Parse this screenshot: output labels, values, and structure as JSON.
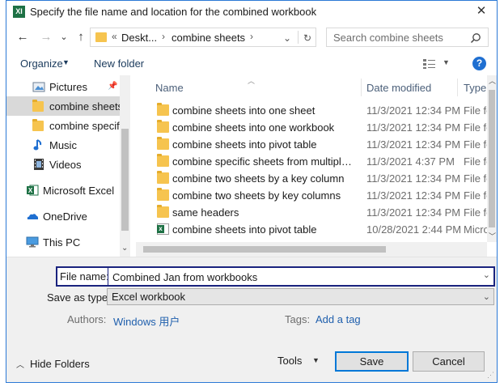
{
  "window": {
    "title": "Specify the file name and location for the combined workbook",
    "logo": "XI",
    "close": "✕"
  },
  "nav": {
    "back": "←",
    "forward": "→",
    "recent": "⌄",
    "up": "↑",
    "breadcrumb": [
      "«",
      "Deskt...",
      "›",
      "combine sheets",
      "›"
    ],
    "dropdown": "⌄",
    "refresh": "↻",
    "search_placeholder": "Search combine sheets"
  },
  "toolbar": {
    "organize": "Organize",
    "new_folder": "New folder",
    "help": "?"
  },
  "sidebar": {
    "items": [
      {
        "label": "Pictures",
        "icon": "pictures-icon"
      },
      {
        "label": "combine sheets",
        "icon": "folder-icon"
      },
      {
        "label": "combine specific",
        "icon": "folder-icon"
      },
      {
        "label": "Music",
        "icon": "music-icon"
      },
      {
        "label": "Videos",
        "icon": "videos-icon"
      },
      {
        "label": "Microsoft Excel",
        "icon": "excel-icon"
      },
      {
        "label": "OneDrive",
        "icon": "onedrive-icon"
      },
      {
        "label": "This PC",
        "icon": "this-pc-icon"
      }
    ]
  },
  "files": {
    "columns": {
      "name": "Name",
      "date": "Date modified",
      "type": "Type"
    },
    "rows": [
      {
        "name": "combine sheets into one sheet",
        "date": "11/3/2021 12:34 PM",
        "type": "File folder",
        "kind": "folder"
      },
      {
        "name": "combine sheets into one workbook",
        "date": "11/3/2021 12:34 PM",
        "type": "File folder",
        "kind": "folder"
      },
      {
        "name": "combine sheets into pivot table",
        "date": "11/3/2021 12:34 PM",
        "type": "File folder",
        "kind": "folder"
      },
      {
        "name": "combine specific sheets from multiple workbooks",
        "date": "11/3/2021 4:37 PM",
        "type": "File folder",
        "kind": "folder"
      },
      {
        "name": "combine two sheets by a key column",
        "date": "11/3/2021 12:34 PM",
        "type": "File folder",
        "kind": "folder"
      },
      {
        "name": "combine two sheets by key columns",
        "date": "11/3/2021 12:34 PM",
        "type": "File folder",
        "kind": "folder"
      },
      {
        "name": "same headers",
        "date": "11/3/2021 12:34 PM",
        "type": "File folder",
        "kind": "folder"
      },
      {
        "name": "combine sheets into pivot table",
        "date": "10/28/2021 2:44 PM",
        "type": "Microsoft Excel Worksheet",
        "kind": "excel"
      }
    ]
  },
  "form": {
    "file_name_label": "File name:",
    "file_name_value": "Combined Jan from workbooks",
    "save_type_label": "Save as type:",
    "save_type_value": "Excel workbook",
    "authors_label": "Authors:",
    "authors_value": "Windows 用户",
    "tags_label": "Tags:",
    "tags_value": "Add a tag"
  },
  "footer": {
    "hide_folders": "Hide Folders",
    "tools": "Tools",
    "save": "Save",
    "cancel": "Cancel"
  },
  "colors": {
    "accent": "#0078d7",
    "window_border": "#2b79d6",
    "folder": "#f6c44f",
    "excel": "#1e7145"
  }
}
